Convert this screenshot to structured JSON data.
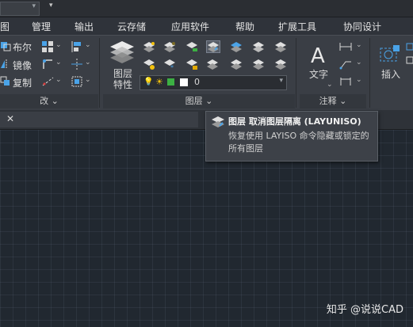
{
  "top": {
    "caret": "▾"
  },
  "menubar": {
    "items": [
      "图",
      "管理",
      "输出",
      "云存储",
      "应用软件",
      "帮助",
      "扩展工具",
      "协同设计"
    ]
  },
  "modify_panel": {
    "buttons": [
      "布尔",
      "镜像",
      "复制"
    ],
    "title": "修改",
    "title_visible": "改 ⌄"
  },
  "layer_panel": {
    "layer_props_label": [
      "图层",
      "特性"
    ],
    "current_layer": "0",
    "title": "图层 ⌄"
  },
  "annotate_panel": {
    "text_label": "文字",
    "title": "注释 ⌄"
  },
  "insert_panel": {
    "insert_label": "插入"
  },
  "tab": {
    "close": "✕"
  },
  "tooltip": {
    "title": "图层 取消图层隔离 (LAYUNISO)",
    "body": "恢复使用 LAYISO 命令隐藏或锁定的所有图层"
  },
  "watermark": "知乎 @说说CAD",
  "colors": {
    "accent_blue": "#4aa3e8",
    "layer_on": "#f4c20d",
    "layer_lock": "#e0a800"
  }
}
